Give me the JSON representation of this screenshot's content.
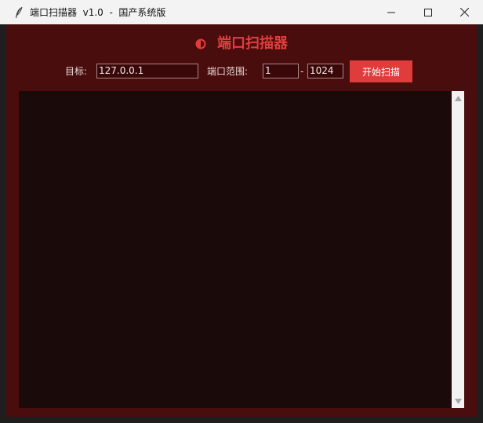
{
  "window": {
    "title": "端口扫描器  v1.0  -  国产系统版",
    "icon": "feather-icon",
    "controls": [
      "minimize-icon",
      "maximize-icon",
      "close-icon"
    ]
  },
  "header": {
    "icon": "half-circle-icon",
    "title": "端口扫描器"
  },
  "form": {
    "target_label": "目标:",
    "target_value": "127.0.0.1",
    "range_label": "端口范围:",
    "port_start": "1",
    "separator": "-",
    "port_end": "1024",
    "scan_button": "开始扫描"
  },
  "output": {
    "text": ""
  },
  "colors": {
    "accent": "#e03c3c",
    "background": "#4a0d0d",
    "output_bg": "#1b0a0a"
  }
}
